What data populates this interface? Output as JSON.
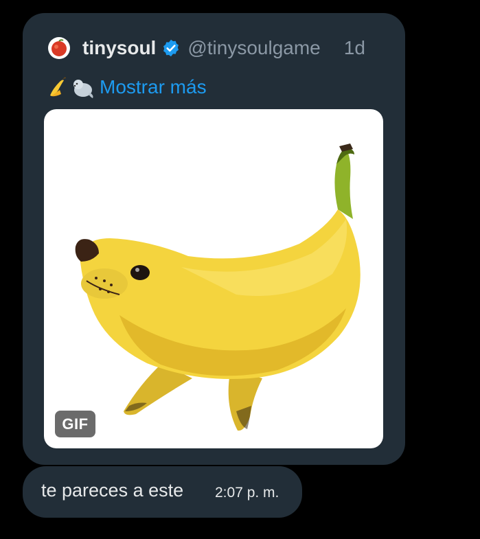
{
  "tweet": {
    "display_name": "tinysoul",
    "handle": "@tinysoulgame",
    "time_ago": "1d",
    "emojis": [
      "banana-emoji",
      "seal-emoji"
    ],
    "show_more_label": "Mostrar más",
    "media": {
      "type": "gif",
      "badge_label": "GIF",
      "subject": "banana-seal-image"
    },
    "colors": {
      "card_bg": "#222e38",
      "link": "#1d9bf0",
      "verified": "#1d9bf0",
      "secondary_text": "#8b98a5",
      "primary_text": "#e7e9ea"
    }
  },
  "message": {
    "text": "te pareces a este",
    "time": "2:07 p. m."
  }
}
